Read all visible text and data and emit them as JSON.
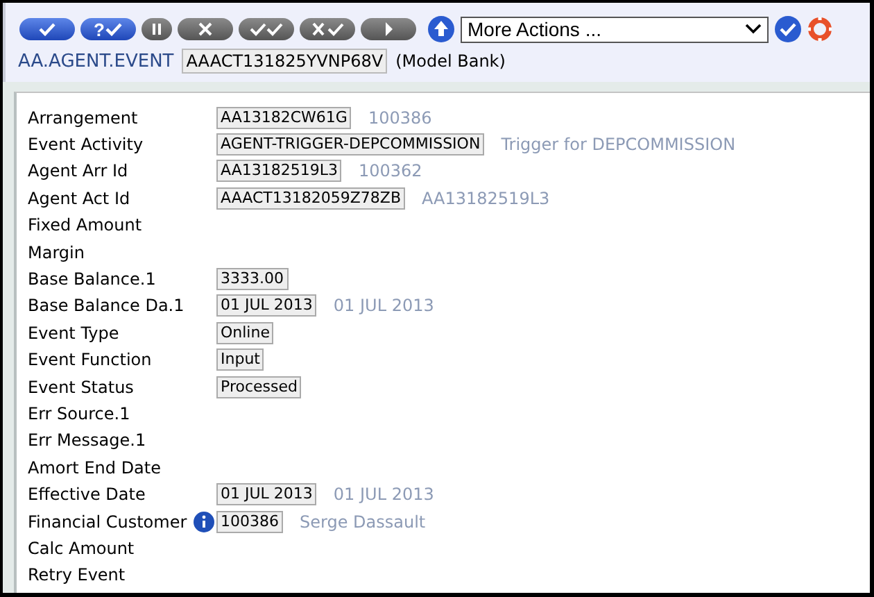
{
  "toolbar": {
    "buttons": [
      {
        "kind": "commit",
        "enabled": true
      },
      {
        "kind": "validate",
        "label": "?",
        "enabled": true
      },
      {
        "kind": "hold",
        "enabled": false
      },
      {
        "kind": "delete",
        "enabled": false
      },
      {
        "kind": "authorise",
        "enabled": false
      },
      {
        "kind": "reverse",
        "enabled": false
      },
      {
        "kind": "next",
        "enabled": false
      }
    ],
    "more_actions": {
      "value": "More Actions ..."
    }
  },
  "header": {
    "application": "AA.AGENT.EVENT",
    "record_id": "AAACT131825YVNP68V",
    "company": "(Model Bank)"
  },
  "fields": [
    {
      "label": "Arrangement",
      "value": "AA13182CW61G",
      "description": "100386"
    },
    {
      "label": "Event Activity",
      "value": "AGENT-TRIGGER-DEPCOMMISSION",
      "description": "Trigger for DEPCOMMISSION"
    },
    {
      "label": "Agent Arr Id",
      "value": "AA13182519L3",
      "description": "100362"
    },
    {
      "label": "Agent Act Id",
      "value": "AAACT13182059Z78ZB",
      "description": "AA13182519L3"
    },
    {
      "label": "Fixed Amount"
    },
    {
      "label": "Margin"
    },
    {
      "label": "Base Balance.1",
      "value": "3333.00"
    },
    {
      "label": "Base Balance Da.1",
      "value": "01 JUL 2013",
      "description": "01 JUL 2013"
    },
    {
      "label": "Event Type",
      "value": "Online"
    },
    {
      "label": "Event Function",
      "value": "Input"
    },
    {
      "label": "Event Status",
      "value": "Processed"
    },
    {
      "label": "Err Source.1"
    },
    {
      "label": "Err Message.1"
    },
    {
      "label": "Amort End Date"
    },
    {
      "label": "Effective Date",
      "value": "01 JUL 2013",
      "description": "01 JUL 2013"
    },
    {
      "label": "Financial Customer",
      "info": true,
      "value": "100386",
      "description": "Serge Dassault"
    },
    {
      "label": "Calc Amount"
    },
    {
      "label": "Retry Event"
    }
  ]
}
